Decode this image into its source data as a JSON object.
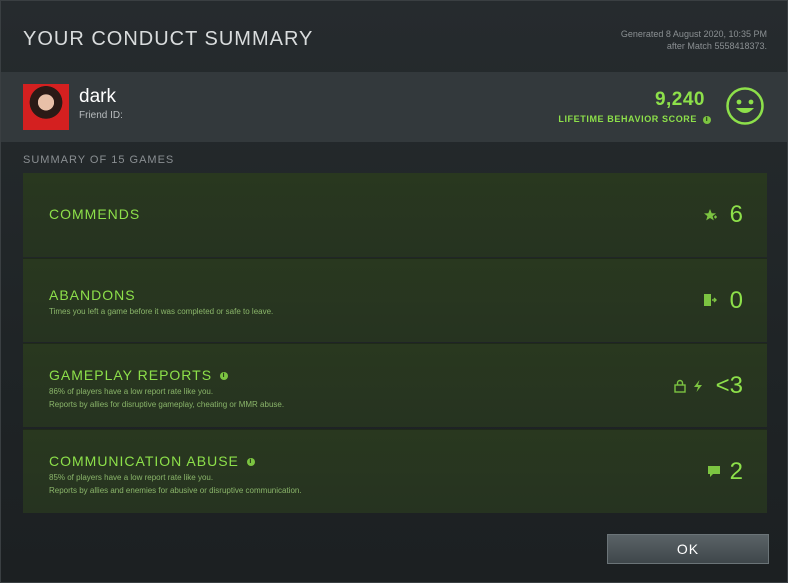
{
  "dialog": {
    "title": "YOUR CONDUCT SUMMARY",
    "generated_line1": "Generated 8 August 2020, 10:35 PM",
    "generated_line2": "after Match 5558418373."
  },
  "profile": {
    "name": "dark",
    "friend_id_label": "Friend ID:",
    "score": "9,240",
    "score_label": "LIFETIME BEHAVIOR SCORE"
  },
  "summary_label": "SUMMARY OF 15 GAMES",
  "panels": [
    {
      "title": "COMMENDS",
      "subtitle1": "",
      "subtitle2": "",
      "value": "6",
      "icon": "star-plus-icon"
    },
    {
      "title": "ABANDONS",
      "subtitle1": "Times you left a game before it was completed or safe to leave.",
      "subtitle2": "",
      "value": "0",
      "icon": "door-exit-icon"
    },
    {
      "title": "GAMEPLAY REPORTS",
      "subtitle1": "86% of players have a low report rate like you.",
      "subtitle2": "Reports by allies for disruptive gameplay, cheating or MMR abuse.",
      "value": "<3",
      "icon": "lightning-icon"
    },
    {
      "title": "COMMUNICATION ABUSE",
      "subtitle1": "85% of players have a low report rate like you.",
      "subtitle2": "Reports by allies and enemies for abusive or disruptive communication.",
      "value": "2",
      "icon": "chat-bubble-icon"
    }
  ],
  "buttons": {
    "ok": "OK"
  },
  "colors": {
    "accent": "#8de04a",
    "panel": "#29381f"
  }
}
